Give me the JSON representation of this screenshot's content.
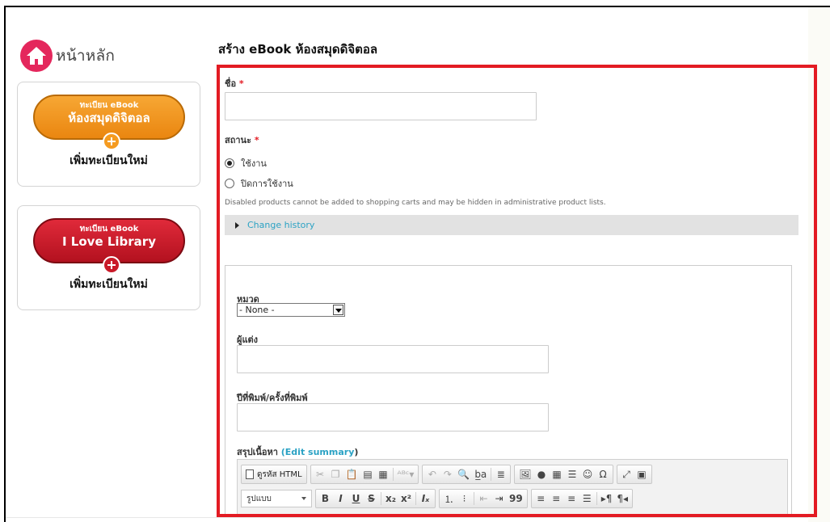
{
  "sidebar": {
    "home_label": "หน้าหลัก",
    "panels": [
      {
        "button_line1": "ทะเบียน eBook",
        "button_line2": "ห้องสมุดดิจิตอล",
        "add_label": "เพิ่มทะเบียนใหม่",
        "color": "#f39a1f"
      },
      {
        "button_line1": "ทะเบียน eBook",
        "button_line2": "I Love Library",
        "add_label": "เพิ่มทะเบียนใหม่",
        "color": "#d01f2e"
      }
    ]
  },
  "page": {
    "title": "สร้าง eBook ห้องสมุดดิจิตอล"
  },
  "form": {
    "name_label": "ชื่อ",
    "required_mark": "*",
    "name_value": "",
    "status_label": "สถานะ",
    "status_options": [
      {
        "label": "ใช้งาน",
        "checked": true
      },
      {
        "label": "ปิดการใช้งาน",
        "checked": false
      }
    ],
    "status_help": "Disabled products cannot be added to shopping carts and may be hidden in administrative product lists.",
    "change_history": "Change history",
    "category_label": "หมวด",
    "category_selected": "- None -",
    "author_label": "ผู้แต่ง",
    "author_value": "",
    "year_label": "ปีที่พิมพ์/ครั้งที่พิมพ์",
    "year_value": "",
    "summary_label": "สรุปเนื้อหา",
    "summary_link_open": "(",
    "summary_link": "Edit summary",
    "summary_link_close": ")"
  },
  "editor": {
    "source_label": "ดูรหัส HTML",
    "format_label": "รูปแบบ",
    "row1_buttons": [
      "cut",
      "copy",
      "paste",
      "paste-text",
      "paste-word",
      "spellcheck",
      "undo",
      "redo",
      "find",
      "replace",
      "select-all",
      "image",
      "flash",
      "table",
      "horizontal-rule",
      "smiley",
      "special-char",
      "maximize",
      "show-blocks"
    ],
    "row2_buttons": [
      "bold",
      "italic",
      "underline",
      "strike",
      "subscript",
      "superscript",
      "remove-format",
      "numbered-list",
      "bulleted-list",
      "outdent",
      "indent",
      "blockquote",
      "align-left",
      "align-center",
      "align-right",
      "justify",
      "ltr",
      "rtl"
    ]
  },
  "colors": {
    "highlight_border": "#e31b23",
    "link": "#2ba2c4",
    "home_icon": "#e4275c"
  }
}
